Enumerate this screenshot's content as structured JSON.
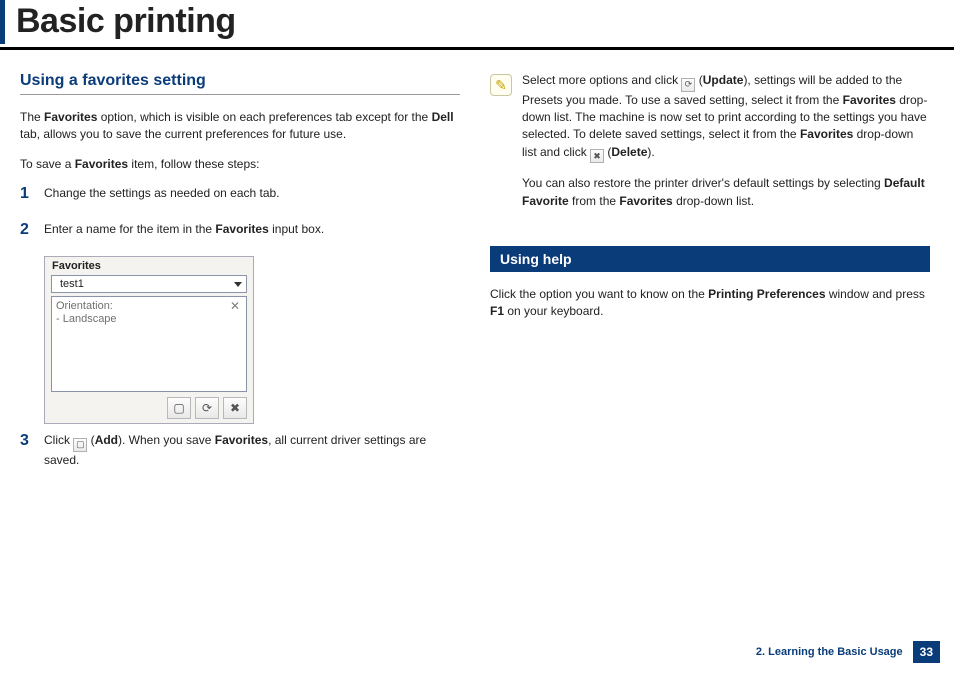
{
  "header": {
    "title": "Basic printing"
  },
  "left": {
    "heading": "Using a favorites setting",
    "intro_parts": [
      "The ",
      "Favorites",
      " option, which is visible on each preferences tab except for the ",
      "Dell",
      " tab, allows you to save the current preferences for future use."
    ],
    "save_intro_parts": [
      "To save a ",
      "Favorites",
      " item, follow these steps:"
    ],
    "steps": {
      "s1": {
        "num": "1",
        "text": "Change the settings as needed on each tab."
      },
      "s2": {
        "num": "2",
        "parts": [
          "Enter a name for the item in the ",
          "Favorites",
          " input box."
        ]
      },
      "s3": {
        "num": "3",
        "parts_a": "Click ",
        "add_label": "Add",
        "parts_b": "). When you save ",
        "fav_word": "Favorites",
        "parts_c": ", all current driver settings are saved."
      }
    },
    "panel": {
      "title": "Favorites",
      "selected": "test1",
      "line1": "Orientation:",
      "line2": "- Landscape"
    }
  },
  "right": {
    "note": {
      "p1_parts": [
        "Select more options and click ",
        " (",
        "Update",
        "), settings will be added to the Presets you made. To use a saved setting, select it from the ",
        "Favorites",
        " drop-down list. The machine is now set to print according to the settings you have selected. To delete saved settings, select it from the ",
        "Favorites",
        " drop-down list and click ",
        " (",
        "Delete",
        ")."
      ],
      "p2_parts": [
        "You can also restore the printer driver's default settings by selecting ",
        "Default Favorite",
        " from the ",
        "Favorites",
        " drop-down list."
      ]
    },
    "help_heading": "Using help",
    "help_parts": [
      "Click the option you want to know on the ",
      "Printing Preferences",
      " window and press ",
      "F1",
      " on your keyboard."
    ]
  },
  "footer": {
    "chapter": "2. Learning the Basic Usage",
    "page": "33"
  }
}
